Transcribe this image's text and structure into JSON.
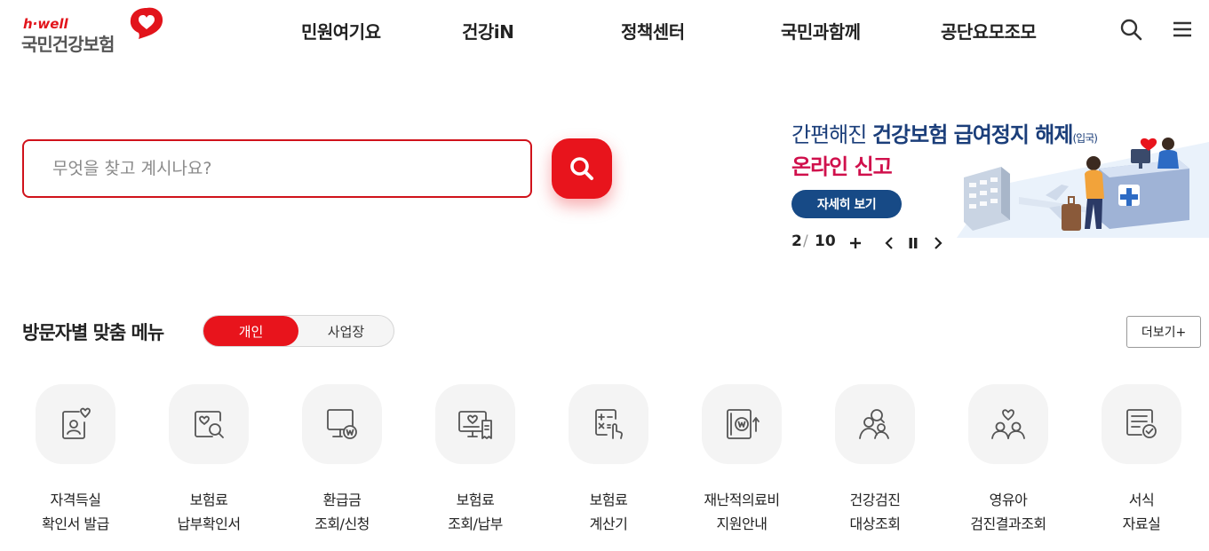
{
  "brand": {
    "tagline": "h·well",
    "name": "국민건강보험",
    "accent_color": "#e8141c"
  },
  "nav": {
    "items": [
      "민원여기요",
      "건강iN",
      "정책센터",
      "국민과함께",
      "공단요모조모"
    ],
    "search_icon": "search-icon",
    "menu_icon": "hamburger-menu-icon"
  },
  "search": {
    "placeholder": "무엇을 찾고 계시나요?",
    "value": ""
  },
  "banner": {
    "line1_prefix": "간편해진 ",
    "line1_bold": "건강보험 급여정지 해제",
    "line1_suffix": "(입국)",
    "line2": "온라인 신고",
    "button": "자세히 보기",
    "headline_color": "#1b3e7a",
    "highlight_color": "#d0104c"
  },
  "pager": {
    "current": "2",
    "separator": "/",
    "total": "10"
  },
  "visitor_menu": {
    "title": "방문자별 맞춤 메뉴",
    "tabs": [
      "개인",
      "사업장"
    ],
    "active_tab": "개인",
    "more": "더보기+",
    "items": [
      {
        "line1": "자격득실",
        "line2": "확인서 발급",
        "icon": "id-card-heart-icon"
      },
      {
        "line1": "보험료",
        "line2": "납부확인서",
        "icon": "document-search-icon"
      },
      {
        "line1": "환급금",
        "line2": "조회/신청",
        "icon": "monitor-won-icon"
      },
      {
        "line1": "보험료",
        "line2": "조회/납부",
        "icon": "monitor-receipt-icon"
      },
      {
        "line1": "보험료",
        "line2": "계산기",
        "icon": "calculator-hand-icon"
      },
      {
        "line1": "재난적의료비",
        "line2": "지원안내",
        "icon": "document-won-icon"
      },
      {
        "line1": "건강검진",
        "line2": "대상조회",
        "icon": "people-search-icon"
      },
      {
        "line1": "영유아",
        "line2": "검진결과조회",
        "icon": "family-heart-icon"
      },
      {
        "line1": "서식",
        "line2": "자료실",
        "icon": "document-check-icon"
      }
    ]
  }
}
